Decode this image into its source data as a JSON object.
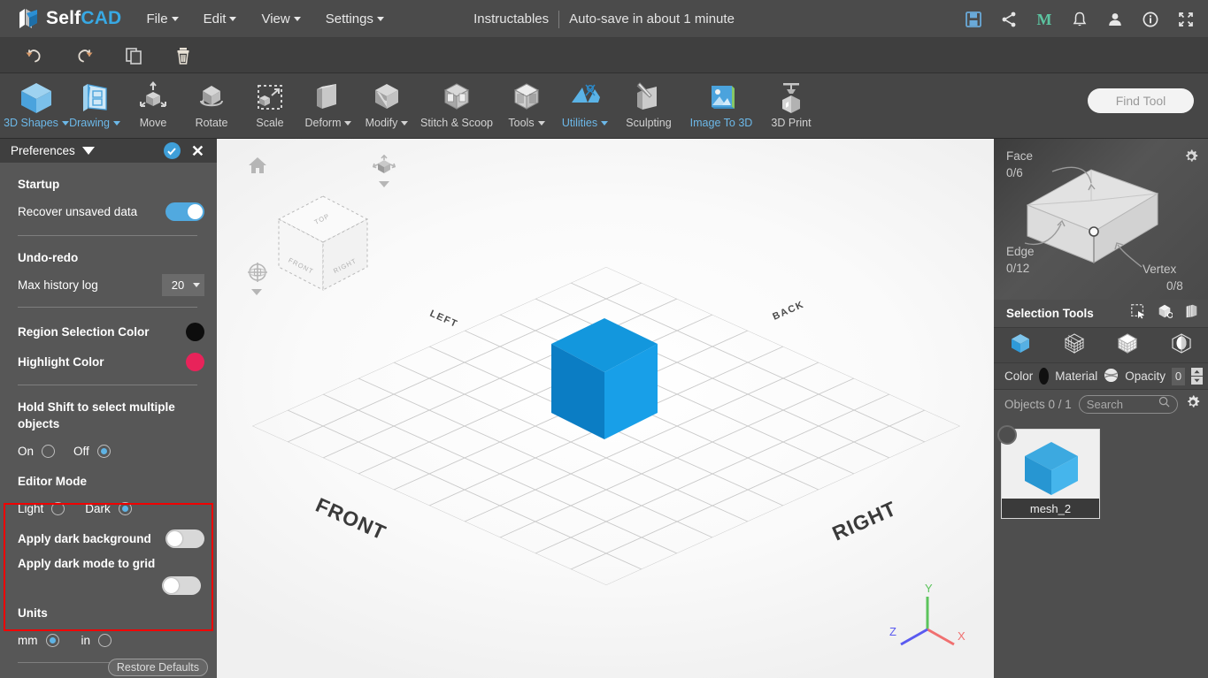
{
  "app": {
    "logo_self": "Self",
    "logo_cad": "CAD",
    "logo_icon": "selfcad-logo-icon"
  },
  "menu": {
    "items": [
      {
        "label": "File",
        "caret": true
      },
      {
        "label": "Edit",
        "caret": true
      },
      {
        "label": "View",
        "caret": true
      },
      {
        "label": "Settings",
        "caret": true
      }
    ]
  },
  "header": {
    "project_name": "Instructables",
    "autosave": "Auto-save in about 1 minute",
    "icons": [
      {
        "name": "save-icon"
      },
      {
        "name": "share-icon"
      },
      {
        "name": "m-logo-icon"
      },
      {
        "name": "notifications-bell-icon"
      },
      {
        "name": "user-account-icon"
      },
      {
        "name": "info-icon"
      },
      {
        "name": "fullscreen-icon"
      }
    ]
  },
  "editbar": {
    "items": [
      {
        "name": "undo-icon",
        "label": "Undo"
      },
      {
        "name": "redo-icon",
        "label": "Redo"
      },
      {
        "name": "copy-icon",
        "label": "Copy"
      },
      {
        "name": "delete-icon",
        "label": "Delete"
      }
    ]
  },
  "ribbon": {
    "tools": [
      {
        "label": "3D Shapes",
        "caret": true,
        "accent": true,
        "icon": "cube-icon"
      },
      {
        "label": "Drawing",
        "caret": true,
        "accent": true,
        "icon": "drawing-icon"
      },
      {
        "label": "Move",
        "caret": false,
        "accent": false,
        "icon": "move-icon"
      },
      {
        "label": "Rotate",
        "caret": false,
        "accent": false,
        "icon": "rotate-icon"
      },
      {
        "label": "Scale",
        "caret": false,
        "accent": false,
        "icon": "scale-icon"
      },
      {
        "label": "Deform",
        "caret": true,
        "accent": false,
        "icon": "deform-icon"
      },
      {
        "label": "Modify",
        "caret": true,
        "accent": false,
        "icon": "modify-icon"
      },
      {
        "label": "Stitch & Scoop",
        "caret": false,
        "accent": false,
        "icon": "stitch-scoop-icon"
      },
      {
        "label": "Tools",
        "caret": true,
        "accent": false,
        "icon": "tools-icon"
      },
      {
        "label": "Utilities",
        "caret": true,
        "accent": true,
        "icon": "utilities-icon"
      },
      {
        "label": "Sculpting",
        "caret": false,
        "accent": false,
        "icon": "sculpting-icon"
      },
      {
        "label": "Image To 3D",
        "caret": false,
        "accent": true,
        "icon": "image-to-3d-icon"
      },
      {
        "label": "3D Print",
        "caret": false,
        "accent": false,
        "icon": "3d-print-icon"
      }
    ],
    "find_tool_placeholder": "Find Tool"
  },
  "preferences": {
    "title": "Preferences",
    "startup_heading": "Startup",
    "recover_label": "Recover unsaved data",
    "recover_state": "on",
    "undo_heading": "Undo-redo",
    "max_history_label": "Max history log",
    "max_history_value": "20",
    "region_color_label": "Region Selection Color",
    "region_color_value": "#0d0d0d",
    "highlight_color_label": "Highlight Color",
    "highlight_color_value": "#e8235a",
    "shift_label": "Hold Shift to select multiple objects",
    "shift_on": "On",
    "shift_off": "Off",
    "shift_selected": "Off",
    "editor_mode_heading": "Editor Mode",
    "editor_light": "Light",
    "editor_dark": "Dark",
    "editor_selected": "Dark",
    "dark_bg_label": "Apply dark background",
    "dark_bg_state": "off",
    "dark_grid_label": "Apply dark mode to grid",
    "dark_grid_state": "off",
    "units_heading": "Units",
    "units_mm": "mm",
    "units_in": "in",
    "units_selected": "mm",
    "restore_label": "Restore Defaults",
    "highlight_box_color": "#f00000"
  },
  "viewport": {
    "cube_faces": {
      "top": "TOP",
      "front": "FRONT",
      "right": "RIGHT"
    },
    "ground_labels": {
      "left": "LEFT",
      "back": "BACK",
      "front": "FRONT",
      "right": "RIGHT"
    },
    "axes": {
      "x": "X",
      "y": "Y",
      "z": "Z",
      "x_color": "#f07070",
      "y_color": "#5cc45c",
      "z_color": "#5a5af0"
    },
    "object_color": {
      "top": "#1397dd",
      "left": "#0b7dc4",
      "right": "#189fe8"
    },
    "icons": [
      {
        "name": "home-view-icon"
      },
      {
        "name": "orbit-view-icon"
      },
      {
        "name": "pan-zoom-icon"
      }
    ]
  },
  "right_panel": {
    "face_label": "Face",
    "face_count": "0/6",
    "edge_label": "Edge",
    "edge_count": "0/12",
    "vertex_label": "Vertex",
    "vertex_count": "0/8",
    "settings_icon": "gear-icon",
    "selection_tools_label": "Selection Tools",
    "selection_tool_icons": [
      {
        "name": "rectangle-select-icon"
      },
      {
        "name": "box-select-icon"
      },
      {
        "name": "lasso-select-icon"
      }
    ],
    "mode_icons": [
      {
        "name": "object-mode-icon",
        "active": true
      },
      {
        "name": "vertex-mode-icon",
        "active": false
      },
      {
        "name": "face-mode-icon",
        "active": false
      },
      {
        "name": "mesh-mode-icon",
        "active": false
      }
    ],
    "color_label": "Color",
    "color_value": "#101010",
    "material_label": "Material",
    "material_icon": "material-sphere-icon",
    "opacity_label": "Opacity",
    "opacity_value": "0",
    "objects_label": "Objects 0 / 1",
    "search_placeholder": "Search",
    "search_icon": "search-icon",
    "objects_gear_icon": "gear-icon",
    "objects": [
      {
        "name": "mesh_2",
        "selected": false
      }
    ]
  }
}
